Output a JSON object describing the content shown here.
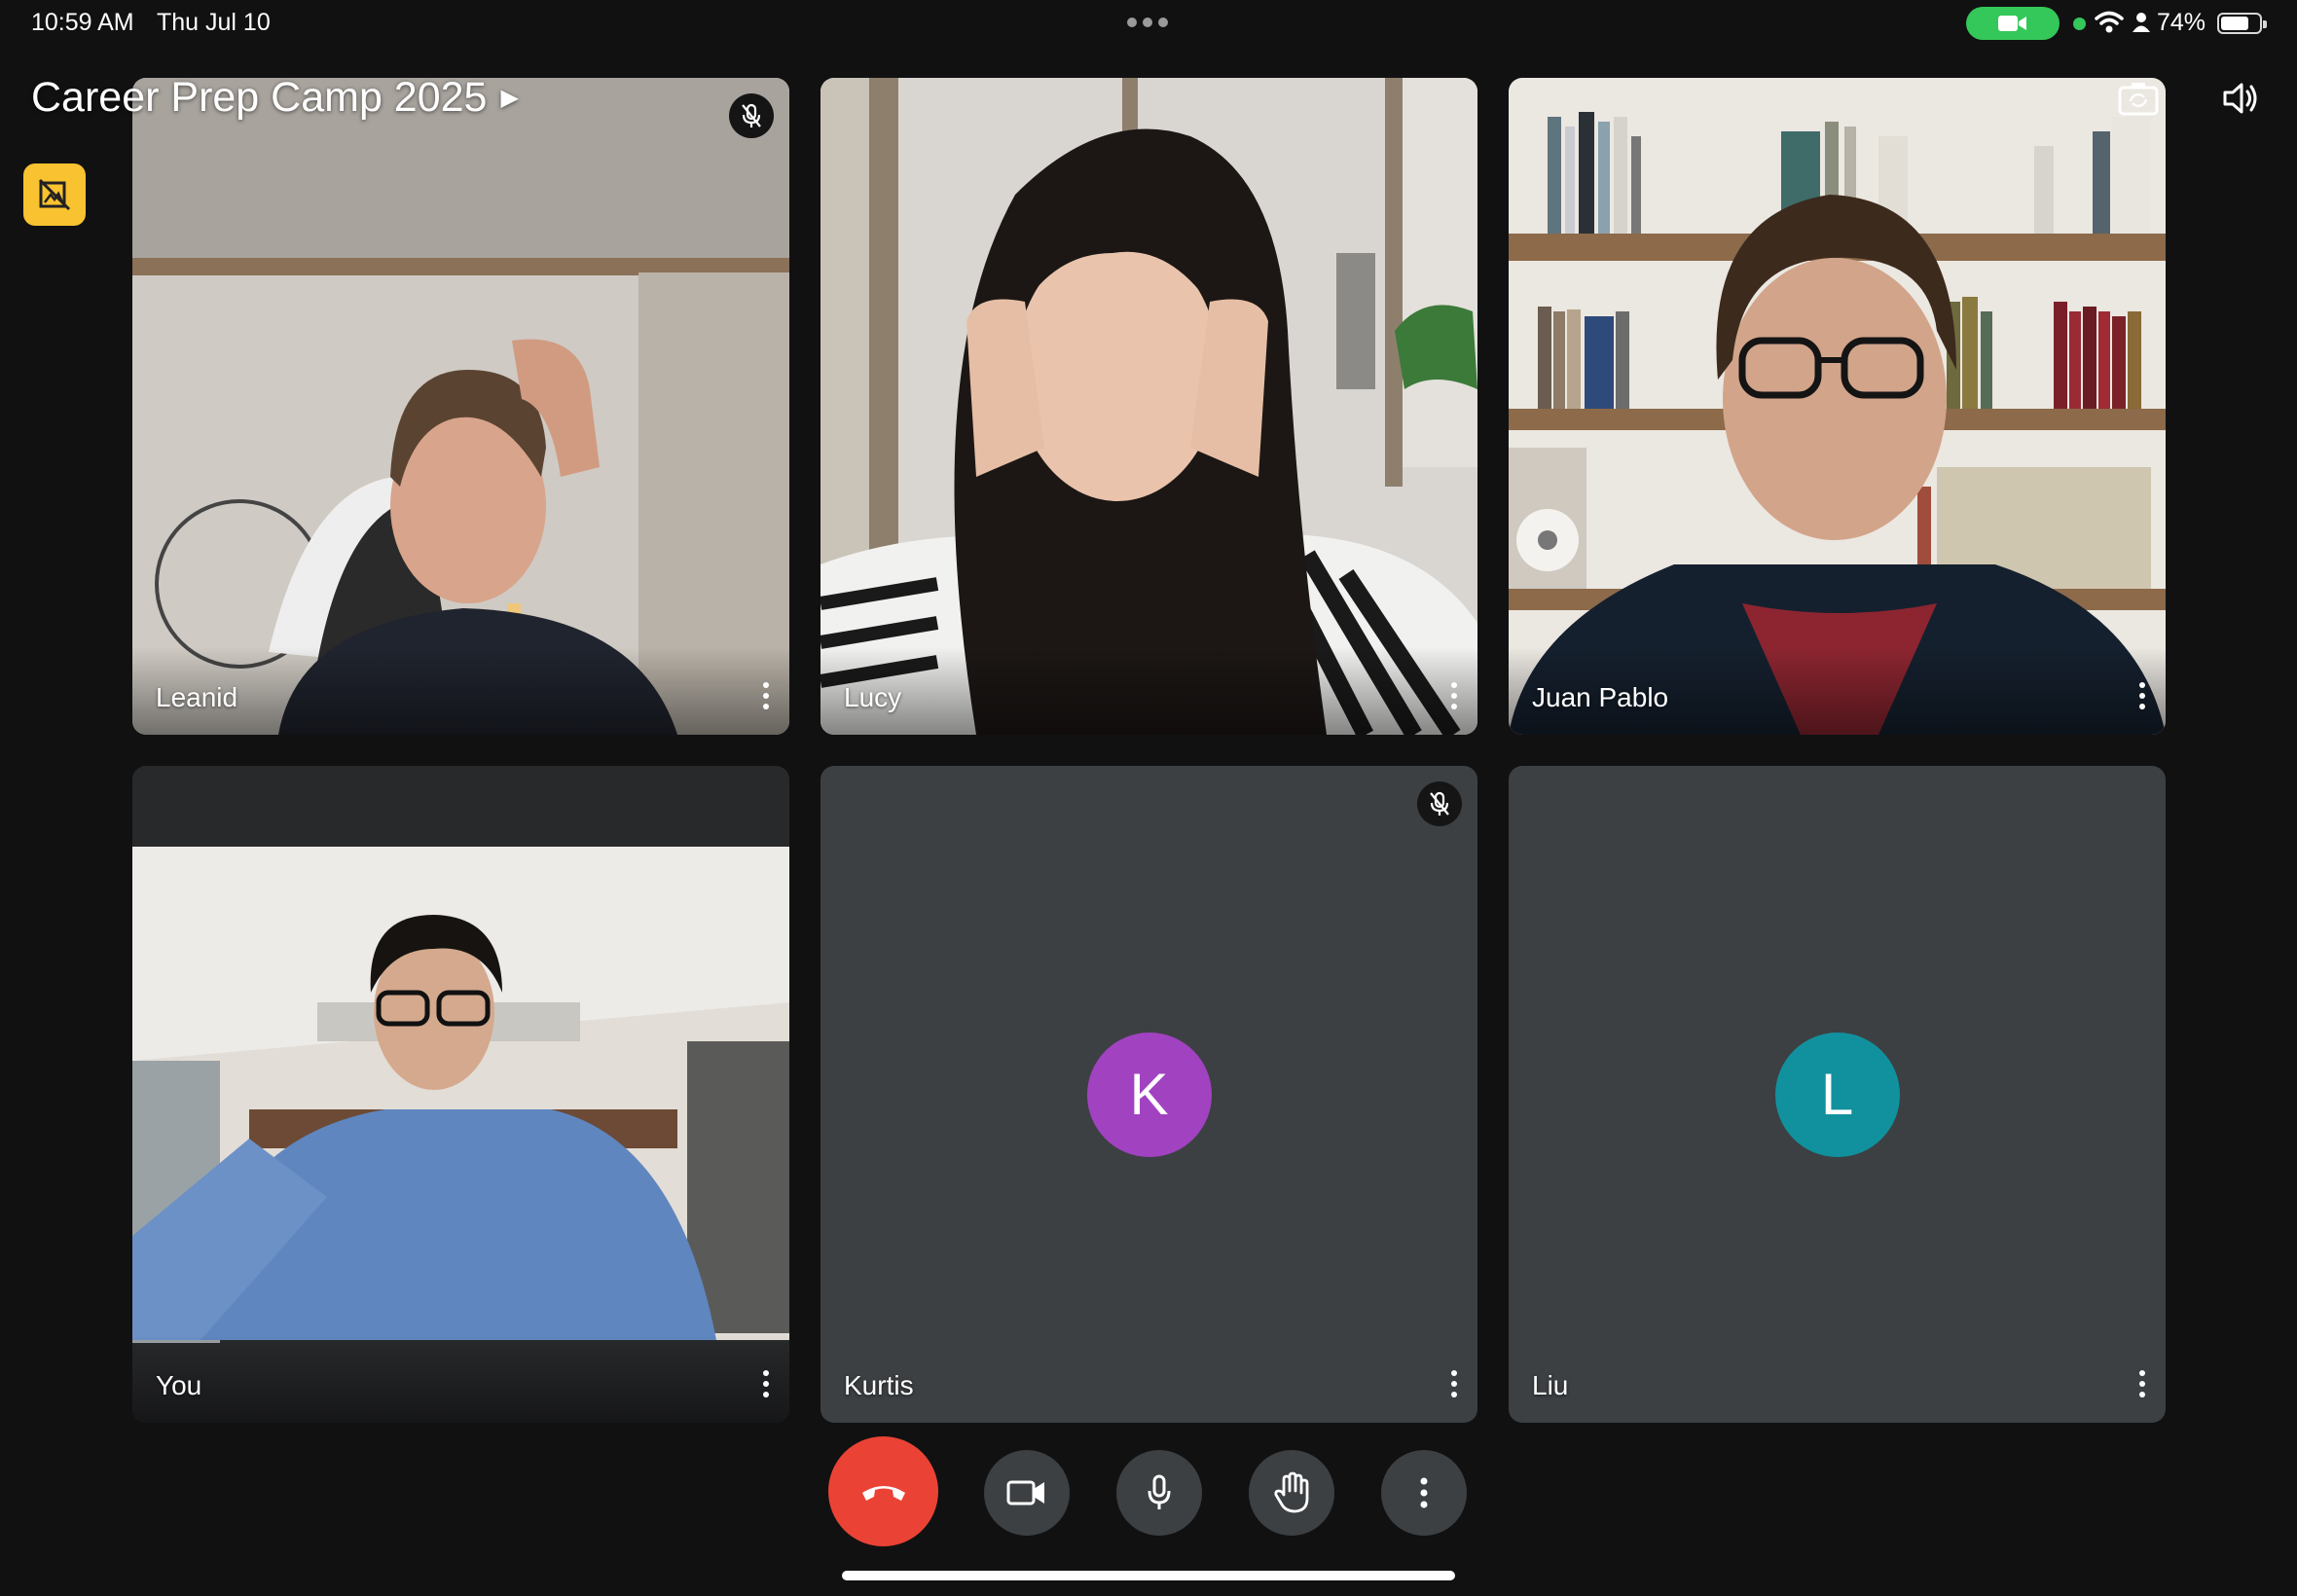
{
  "status_bar": {
    "time": "10:59 AM",
    "date": "Thu Jul 10",
    "battery_percent": "74%",
    "battery_level": 0.74,
    "camera_indicator_color": "#34c759"
  },
  "meeting": {
    "title": "Career Prep Camp 2025",
    "title_chevron_icon": "chevron-right-icon",
    "top_left_button_icon": "no-background-icon",
    "top_right_icons": [
      "switch-camera-icon",
      "speaker-volume-icon"
    ]
  },
  "participants": [
    {
      "name": "Leanid",
      "muted": true,
      "video": true
    },
    {
      "name": "Lucy",
      "muted": false,
      "video": true
    },
    {
      "name": "Juan Pablo",
      "muted": false,
      "video": true
    },
    {
      "name": "You",
      "muted": false,
      "video": true
    },
    {
      "name": "Kurtis",
      "muted": true,
      "video": false,
      "initial": "K",
      "avatar_color": "#a142c1"
    },
    {
      "name": "Liu",
      "muted": false,
      "video": false,
      "initial": "L",
      "avatar_color": "#11919d"
    }
  ],
  "controls": {
    "items": [
      "end-call",
      "camera",
      "microphone",
      "raise-hand",
      "more-options"
    ],
    "end_call_color": "#ea4335",
    "button_color": "#3c4043"
  }
}
